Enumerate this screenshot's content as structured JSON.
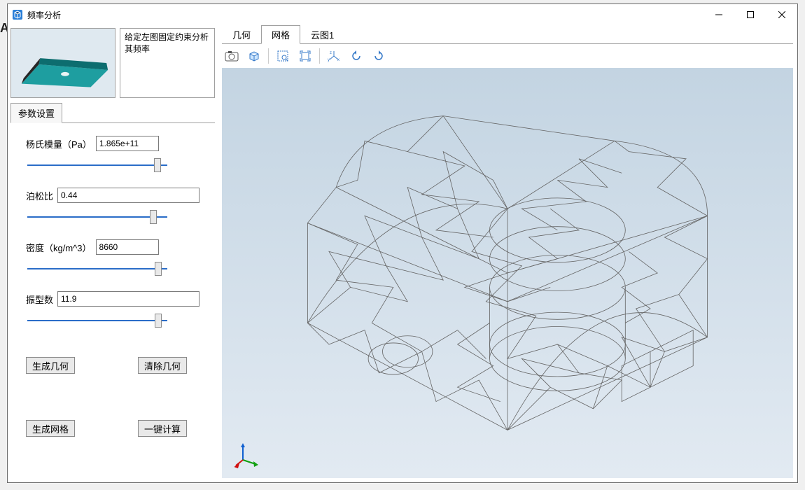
{
  "window": {
    "title": "频率分析"
  },
  "description": "给定左图固定约束分析其频率",
  "group_label": "参数设置",
  "params": {
    "youngs": {
      "label": "杨氏模量（Pa）",
      "value": "1.865e+11"
    },
    "poisson": {
      "label": "泊松比",
      "value": "0.44"
    },
    "density": {
      "label": "密度（kg/m^3）",
      "value": "8660"
    },
    "modes": {
      "label": "振型数",
      "value": "11.9"
    }
  },
  "buttons": {
    "gen_geom": "生成几何",
    "clear_geom": "清除几何",
    "gen_mesh": "生成网格",
    "compute": "一键计算"
  },
  "tabs": {
    "geom": "几何",
    "mesh": "网格",
    "cloud": "云图1"
  }
}
